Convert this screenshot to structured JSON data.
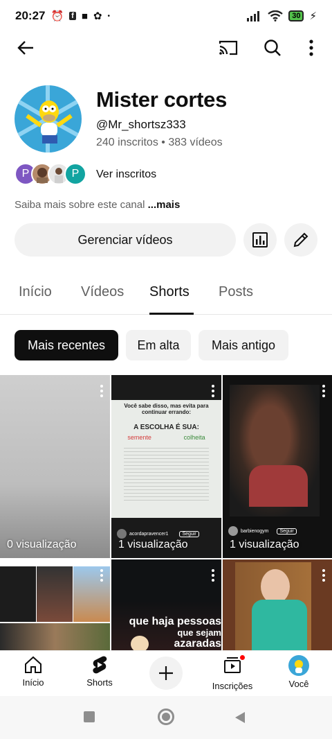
{
  "status_bar": {
    "time": "20:27",
    "battery": "30"
  },
  "channel": {
    "name": "Mister cortes",
    "handle": "@Mr_shortsz333",
    "stats": "240 inscritos • 383 vídeos",
    "subscribers_link": "Ver inscritos",
    "about_prefix": "Saiba mais sobre este canal",
    "about_more": "...mais",
    "manage_button": "Gerenciar vídeos",
    "subscriber_avatars": [
      "P",
      "",
      "",
      "P"
    ]
  },
  "tabs": [
    "Início",
    "Vídeos",
    "Shorts",
    "Posts"
  ],
  "active_tab": "Shorts",
  "chips": [
    "Mais recentes",
    "Em alta",
    "Mais antigo"
  ],
  "active_chip": "Mais recentes",
  "shorts": [
    {
      "views": "0 visualização",
      "caption": ""
    },
    {
      "views": "1 visualização",
      "caption": "Você sabe disso, mas evita para continuar errando:",
      "title": "A ESCOLHA É SUA:",
      "col_left": "semente",
      "col_right": "colheita",
      "creator": "acordapravencer1",
      "follow": "Seguir"
    },
    {
      "views": "1 visualização",
      "creator": "barbienogym",
      "follow": "Seguir"
    },
    {
      "views": ""
    },
    {
      "views": "",
      "overlay_text_1": "que haja pessoas",
      "overlay_text_2": "que sejam",
      "overlay_text_3": "azaradas"
    },
    {
      "views": ""
    }
  ],
  "bottom_nav": {
    "home": "Início",
    "shorts": "Shorts",
    "subscriptions": "Inscrições",
    "you": "Você"
  },
  "colors": {
    "accent_red": "#ff0000",
    "chip_active": "#0f0f0f",
    "chip_bg": "#f2f2f2"
  }
}
